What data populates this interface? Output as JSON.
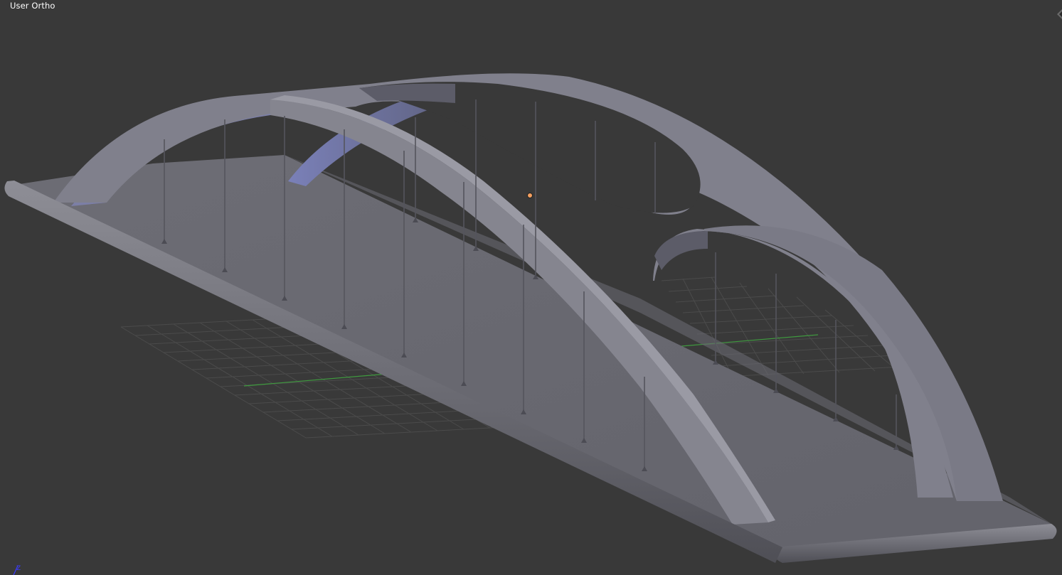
{
  "viewport": {
    "view_label": "User Ortho",
    "background_color": "#393939",
    "axis_indicator": {
      "label": "Z",
      "icon": "axis-z-icon",
      "color": "#3b3bff"
    },
    "corner_widget": {
      "icon": "region-split-corner-icon"
    },
    "floor_grid": {
      "visible": true,
      "line_color": "#4a4a4a",
      "x_axis_color": "#3f9a3f"
    },
    "object_origin": {
      "icon": "object-origin-icon",
      "color": "#f5a060"
    },
    "model": {
      "type": "arch-bridge",
      "shading": "solid",
      "base_color": "#7b7b87",
      "accent_color": "#8a8fc0"
    }
  }
}
